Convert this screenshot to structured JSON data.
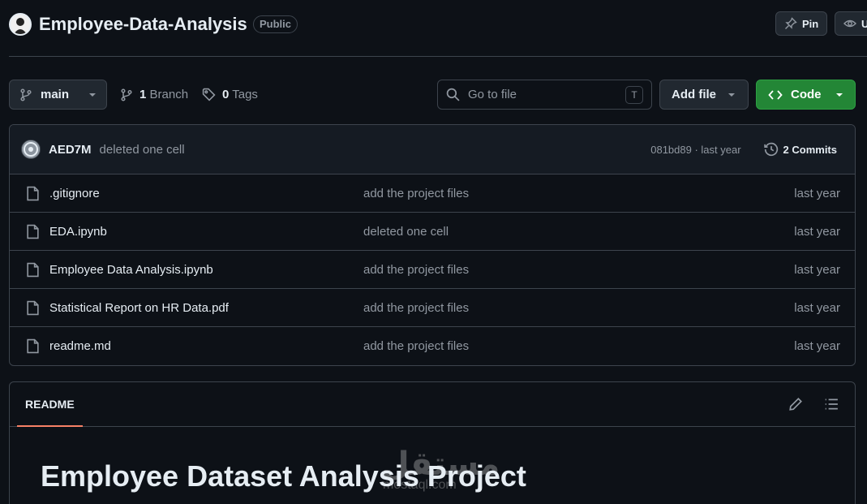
{
  "repo": {
    "name": "Employee-Data-Analysis",
    "visibility": "Public"
  },
  "header_actions": {
    "pin_label": "Pin",
    "watch_label": "U"
  },
  "toolbar": {
    "branch_label": "main",
    "branch_count": "1",
    "branch_word": "Branch",
    "tag_count": "0",
    "tag_word": "Tags",
    "search_placeholder": "Go to file",
    "search_kbd": "T",
    "add_file_label": "Add file",
    "code_label": "Code"
  },
  "latest_commit": {
    "author": "AED7M",
    "message": "deleted one cell",
    "hash_time": "081bd89 · last year",
    "commits_label": "2 Commits"
  },
  "files": [
    {
      "name": ".gitignore",
      "message": "add the project files",
      "date": "last year"
    },
    {
      "name": "EDA.ipynb",
      "message": "deleted one cell",
      "date": "last year"
    },
    {
      "name": "Employee Data Analysis.ipynb",
      "message": "add the project files",
      "date": "last year"
    },
    {
      "name": "Statistical Report on HR Data.pdf",
      "message": "add the project files",
      "date": "last year"
    },
    {
      "name": "readme.md",
      "message": "add the project files",
      "date": "last year"
    }
  ],
  "readme": {
    "tab_label": "README",
    "heading": "Employee Dataset Analysis Project"
  },
  "watermark": {
    "arabic": "مستقل",
    "latin": "mostaql.com"
  },
  "colors": {
    "background": "#0d1117",
    "code_button": "#238636",
    "tab_underline": "#f78166"
  }
}
